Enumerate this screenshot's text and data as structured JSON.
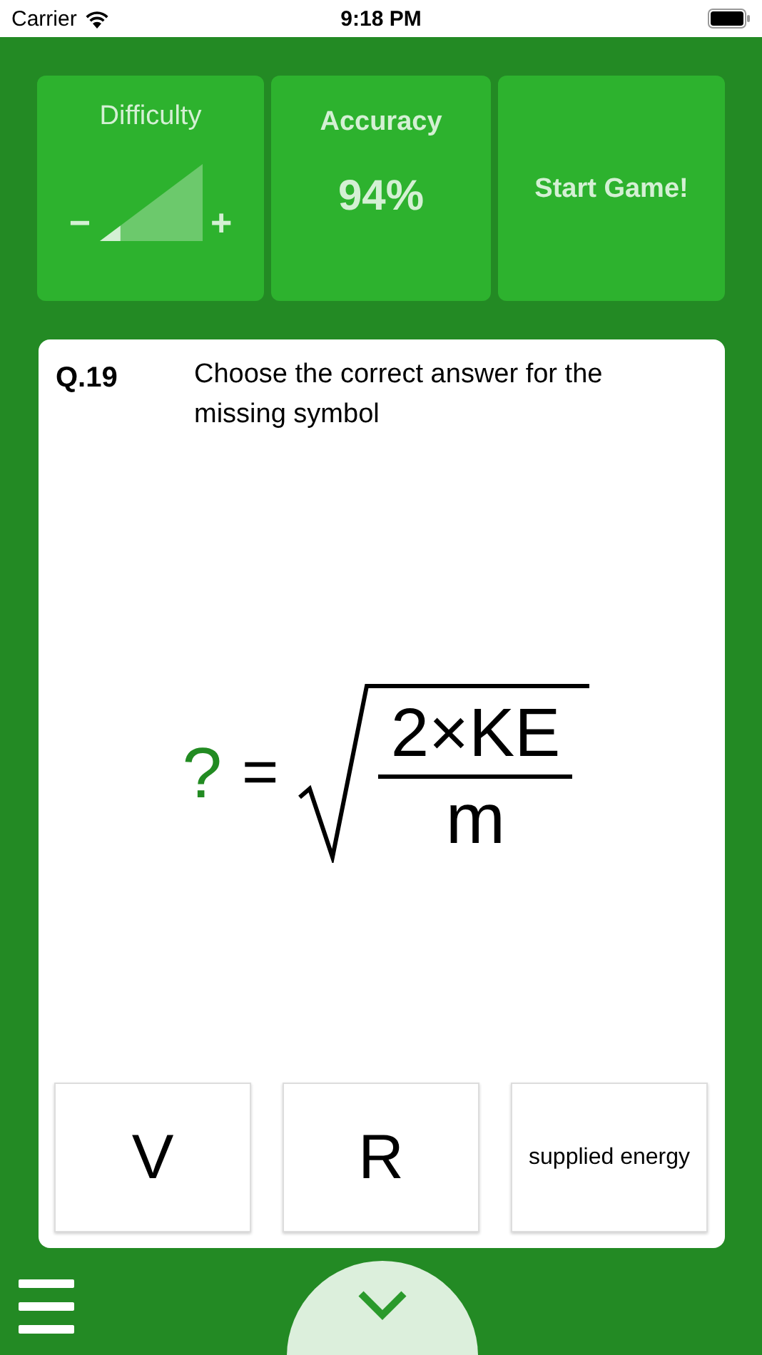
{
  "status_bar": {
    "carrier": "Carrier",
    "time": "9:18 PM"
  },
  "difficulty": {
    "label": "Difficulty",
    "minus": "−",
    "plus": "+",
    "level": 0.2
  },
  "accuracy": {
    "label": "Accuracy",
    "value": "94%"
  },
  "start_button": {
    "label": "Start Game!"
  },
  "question": {
    "number": "Q.19",
    "prompt": "Choose the correct answer for the missing symbol"
  },
  "formula": {
    "unknown": "?",
    "equals": "=",
    "numerator": "2×KE",
    "denominator": "m"
  },
  "answers": [
    {
      "label": "V",
      "kind": "large"
    },
    {
      "label": "R",
      "kind": "large"
    },
    {
      "label": "supplied energy",
      "kind": "small"
    }
  ]
}
